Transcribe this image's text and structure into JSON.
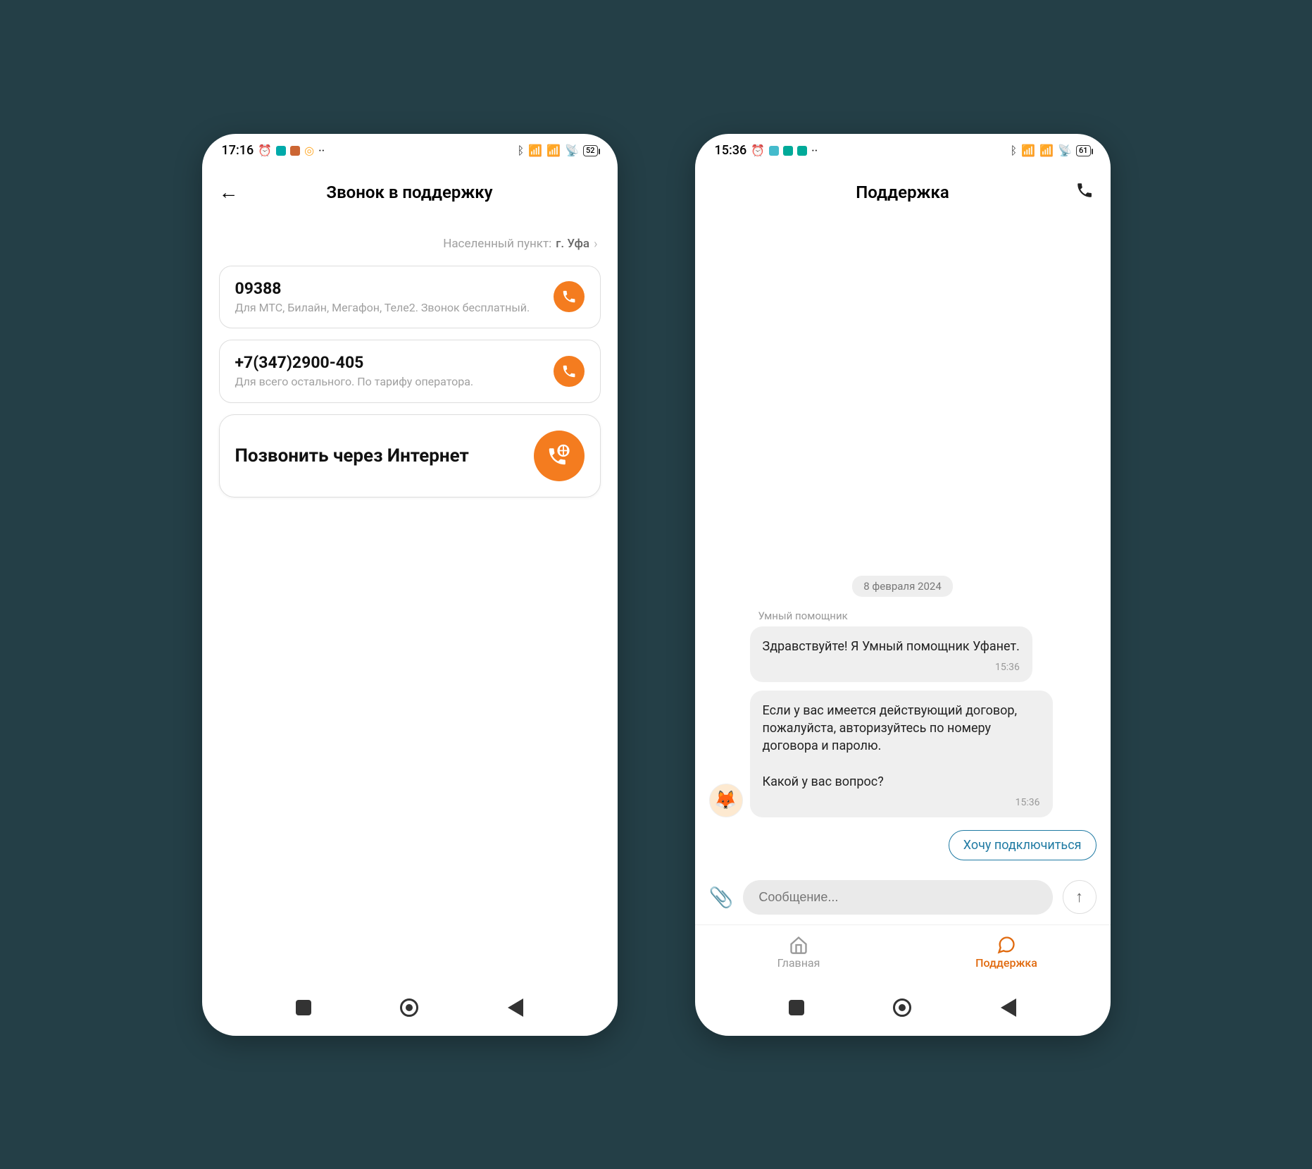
{
  "phone_a": {
    "status": {
      "time": "17:16",
      "battery": "52"
    },
    "header": {
      "title": "Звонок в поддержку"
    },
    "location": {
      "label": "Населенный пункт:",
      "value": "г. Уфа"
    },
    "calls": [
      {
        "title": "09388",
        "sub": "Для МТС, Билайн, Мегафон, Теле2. Звонок бесплатный."
      },
      {
        "title": "+7(347)2900-405",
        "sub": "Для всего остального. По тарифу оператора."
      }
    ],
    "internet_call": {
      "title": "Позвонить через Интернет"
    }
  },
  "phone_b": {
    "status": {
      "time": "15:36",
      "battery": "61"
    },
    "header": {
      "title": "Поддержка"
    },
    "chat": {
      "date": "8 февраля 2024",
      "sender": "Умный помощник",
      "messages": [
        {
          "text": "Здравствуйте! Я Умный помощник Уфанет.",
          "time": "15:36"
        },
        {
          "text": "Если у вас имеется действующий договор, пожалуйста, авторизуйтесь по номеру договора и паролю.\n\nКакой у вас вопрос?",
          "time": "15:36"
        }
      ],
      "chip": "Хочу подключиться",
      "input_placeholder": "Сообщение..."
    },
    "tabs": {
      "home": "Главная",
      "support": "Поддержка"
    }
  }
}
